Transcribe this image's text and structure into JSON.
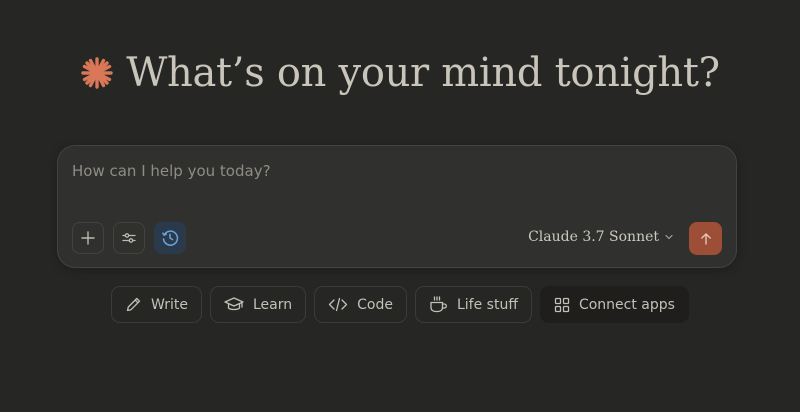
{
  "headline": {
    "text": "What’s on your mind tonight?",
    "icon": "claude-spark-icon"
  },
  "composer": {
    "placeholder": "How can I help you today?",
    "value": "",
    "tools": [
      {
        "icon": "plus-icon"
      },
      {
        "icon": "sliders-icon"
      },
      {
        "icon": "clock-icon",
        "active": true
      }
    ],
    "model": {
      "label": "Claude 3.7 Sonnet",
      "icon": "chevron-down-icon"
    },
    "send": {
      "icon": "arrow-up-icon"
    }
  },
  "chips": [
    {
      "label": "Write",
      "icon": "pencil-icon"
    },
    {
      "label": "Learn",
      "icon": "graduation-cap-icon"
    },
    {
      "label": "Code",
      "icon": "code-icon"
    },
    {
      "label": "Life stuff",
      "icon": "coffee-cup-icon"
    },
    {
      "label": "Connect apps",
      "icon": "apps-grid-icon"
    }
  ],
  "colors": {
    "background": "#262624",
    "accent": "#d97757",
    "send_button": "#9c4e36",
    "active_tool": "#2b3a4b"
  }
}
